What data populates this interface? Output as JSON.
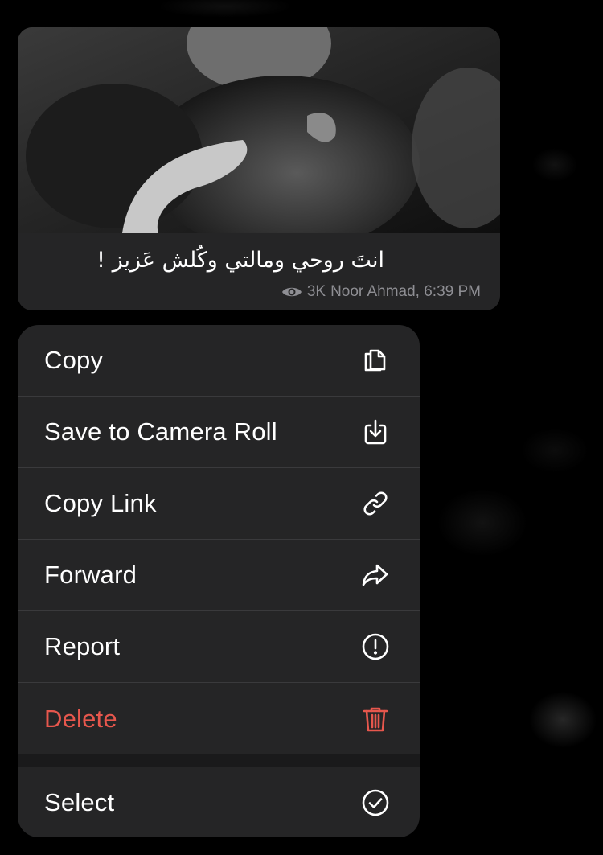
{
  "message": {
    "caption": "انتَ روحي ومالتي وكُلش عَزيز !",
    "views": "3K",
    "author": "Noor Ahmad",
    "time": "6:39 PM",
    "author_time": "Noor Ahmad, 6:39 PM"
  },
  "menu": {
    "items": [
      {
        "label": "Copy",
        "icon": "copy-icon"
      },
      {
        "label": "Save to Camera Roll",
        "icon": "save-download-icon"
      },
      {
        "label": "Copy Link",
        "icon": "link-icon"
      },
      {
        "label": "Forward",
        "icon": "forward-icon"
      },
      {
        "label": "Report",
        "icon": "report-exclamation-icon"
      },
      {
        "label": "Delete",
        "icon": "trash-icon"
      }
    ],
    "select": {
      "label": "Select",
      "icon": "checkmark-circle-icon"
    }
  },
  "colors": {
    "menu_bg": "#252526",
    "text": "#ffffff",
    "danger": "#e7574d",
    "meta": "#8e8e93"
  }
}
